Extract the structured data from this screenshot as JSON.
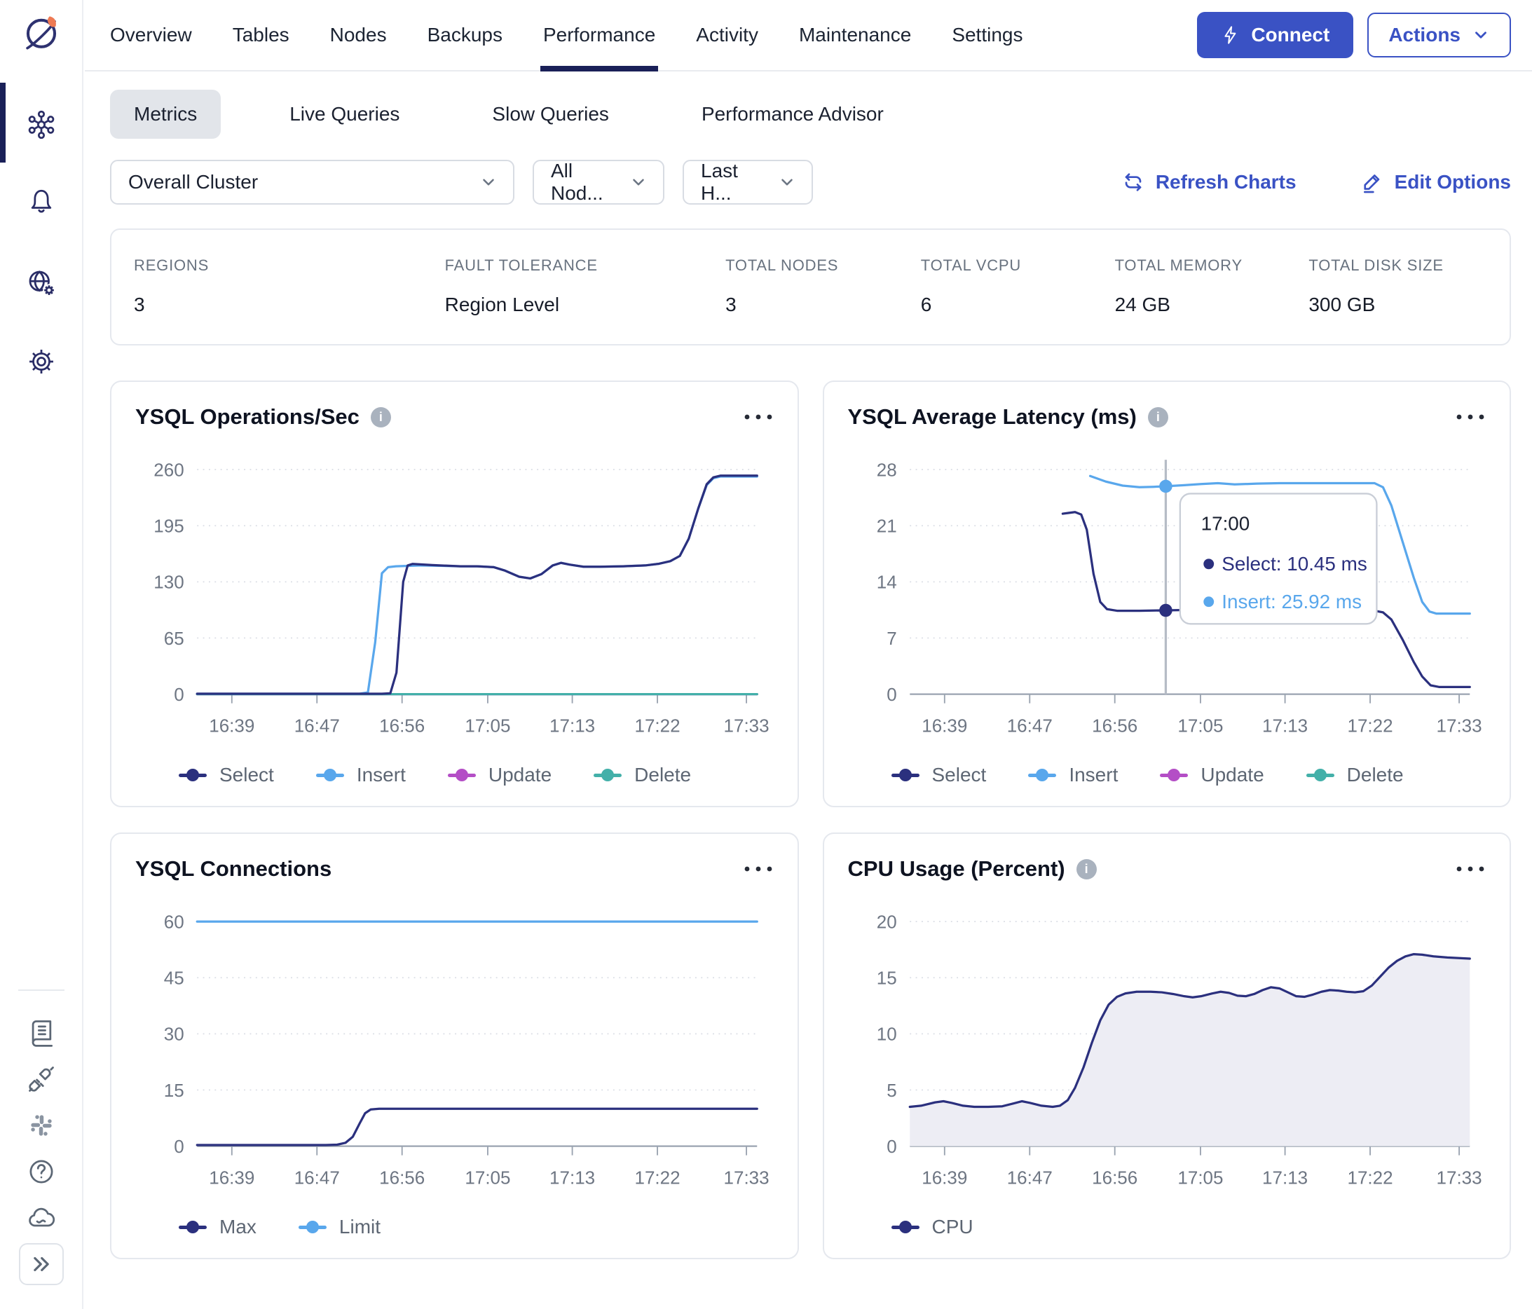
{
  "nav": {
    "tabs": [
      {
        "label": "Overview",
        "active": false
      },
      {
        "label": "Tables",
        "active": false
      },
      {
        "label": "Nodes",
        "active": false
      },
      {
        "label": "Backups",
        "active": false
      },
      {
        "label": "Performance",
        "active": true
      },
      {
        "label": "Activity",
        "active": false
      },
      {
        "label": "Maintenance",
        "active": false
      },
      {
        "label": "Settings",
        "active": false
      }
    ],
    "connect_label": "Connect",
    "actions_label": "Actions"
  },
  "subtabs": {
    "items": [
      {
        "label": "Metrics",
        "active": true
      },
      {
        "label": "Live Queries",
        "active": false
      },
      {
        "label": "Slow Queries",
        "active": false
      },
      {
        "label": "Performance Advisor",
        "active": false
      }
    ]
  },
  "filters": {
    "cluster": {
      "value": "Overall Cluster"
    },
    "nodes": {
      "value": "All Nod..."
    },
    "time": {
      "value": "Last H..."
    },
    "refresh_label": "Refresh Charts",
    "edit_label": "Edit Options"
  },
  "stats": {
    "items": [
      {
        "label": "REGIONS",
        "value": "3"
      },
      {
        "label": "FAULT TOLERANCE",
        "value": "Region Level"
      },
      {
        "label": "TOTAL NODES",
        "value": "3"
      },
      {
        "label": "TOTAL vCPU",
        "value": "6"
      },
      {
        "label": "TOTAL MEMORY",
        "value": "24 GB"
      },
      {
        "label": "TOTAL DISK SIZE",
        "value": "300 GB"
      }
    ]
  },
  "colors": {
    "accent": "#3a52c4",
    "select_series": "#2b307e",
    "insert_series": "#59a7ec",
    "update_series": "#b44ec6",
    "delete_series": "#43b0a9",
    "active_underline": "#1a2058"
  },
  "chart_data": [
    {
      "id": "ysql-operations",
      "type": "line",
      "title": "YSQL Operations/Sec",
      "has_info": true,
      "ylim": [
        0,
        260
      ],
      "y_ticks": [
        0,
        65,
        130,
        195,
        260
      ],
      "x_ticks": [
        "16:39",
        "16:47",
        "16:56",
        "17:05",
        "17:13",
        "17:22",
        "17:33"
      ],
      "x_tick_t": [
        0.062,
        0.214,
        0.366,
        0.519,
        0.67,
        0.822,
        0.981
      ],
      "legend": [
        {
          "label": "Select",
          "color": "#2b307e"
        },
        {
          "label": "Insert",
          "color": "#59a7ec"
        },
        {
          "label": "Update",
          "color": "#b44ec6"
        },
        {
          "label": "Delete",
          "color": "#43b0a9"
        }
      ],
      "series": [
        {
          "name": "Update",
          "color": "#b44ec6",
          "points": [
            [
              0,
              0
            ],
            [
              1,
              0
            ]
          ]
        },
        {
          "name": "Delete",
          "color": "#43b0a9",
          "points": [
            [
              0,
              0
            ],
            [
              1,
              0
            ]
          ]
        },
        {
          "name": "Insert",
          "color": "#59a7ec",
          "points": [
            [
              0,
              0.5
            ],
            [
              0.29,
              0.5
            ],
            [
              0.305,
              2
            ],
            [
              0.318,
              60
            ],
            [
              0.33,
              140
            ],
            [
              0.341,
              147
            ],
            [
              0.355,
              148
            ],
            [
              0.4,
              149
            ],
            [
              0.44,
              148.5
            ],
            [
              0.47,
              148
            ],
            [
              0.5,
              148
            ],
            [
              0.53,
              147
            ],
            [
              0.55,
              143
            ],
            [
              0.575,
              136
            ],
            [
              0.595,
              134
            ],
            [
              0.615,
              139
            ],
            [
              0.635,
              149
            ],
            [
              0.65,
              152
            ],
            [
              0.665,
              150
            ],
            [
              0.69,
              147.5
            ],
            [
              0.72,
              147.5
            ],
            [
              0.76,
              148
            ],
            [
              0.8,
              149
            ],
            [
              0.825,
              151
            ],
            [
              0.845,
              154
            ],
            [
              0.862,
              160
            ],
            [
              0.878,
              180
            ],
            [
              0.895,
              215
            ],
            [
              0.91,
              242
            ],
            [
              0.922,
              250
            ],
            [
              0.935,
              252
            ],
            [
              1,
              252
            ]
          ]
        },
        {
          "name": "Select",
          "color": "#2b307e",
          "points": [
            [
              0,
              0.5
            ],
            [
              0.33,
              0.5
            ],
            [
              0.345,
              1
            ],
            [
              0.356,
              25
            ],
            [
              0.368,
              130
            ],
            [
              0.376,
              149
            ],
            [
              0.385,
              150.8
            ],
            [
              0.42,
              149.5
            ],
            [
              0.47,
              148
            ],
            [
              0.5,
              148
            ],
            [
              0.53,
              147
            ],
            [
              0.55,
              143
            ],
            [
              0.575,
              136
            ],
            [
              0.595,
              134
            ],
            [
              0.615,
              139
            ],
            [
              0.635,
              149
            ],
            [
              0.65,
              152
            ],
            [
              0.665,
              150
            ],
            [
              0.69,
              147.5
            ],
            [
              0.72,
              147.5
            ],
            [
              0.76,
              148
            ],
            [
              0.8,
              149
            ],
            [
              0.825,
              151
            ],
            [
              0.845,
              154
            ],
            [
              0.862,
              160
            ],
            [
              0.878,
              180
            ],
            [
              0.895,
              215
            ],
            [
              0.91,
              243
            ],
            [
              0.922,
              251
            ],
            [
              0.935,
              253
            ],
            [
              1,
              253
            ]
          ]
        }
      ]
    },
    {
      "id": "ysql-latency",
      "type": "line",
      "title": "YSQL Average Latency (ms)",
      "has_info": true,
      "ylim": [
        0,
        28
      ],
      "y_ticks": [
        0,
        7,
        14,
        21,
        28
      ],
      "x_ticks": [
        "16:39",
        "16:47",
        "16:56",
        "17:05",
        "17:13",
        "17:22",
        "17:33"
      ],
      "x_tick_t": [
        0.062,
        0.214,
        0.366,
        0.519,
        0.67,
        0.822,
        0.981
      ],
      "legend": [
        {
          "label": "Select",
          "color": "#2b307e"
        },
        {
          "label": "Insert",
          "color": "#59a7ec"
        },
        {
          "label": "Update",
          "color": "#b44ec6"
        },
        {
          "label": "Delete",
          "color": "#43b0a9"
        }
      ],
      "series": [
        {
          "name": "Insert",
          "color": "#59a7ec",
          "points": [
            [
              0.322,
              27.2
            ],
            [
              0.35,
              26.5
            ],
            [
              0.38,
              26.0
            ],
            [
              0.41,
              25.8
            ],
            [
              0.435,
              25.85
            ],
            [
              0.457,
              25.92
            ],
            [
              0.49,
              26.05
            ],
            [
              0.52,
              26.2
            ],
            [
              0.55,
              26.3
            ],
            [
              0.58,
              26.15
            ],
            [
              0.62,
              26.25
            ],
            [
              0.66,
              26.3
            ],
            [
              0.7,
              26.3
            ],
            [
              0.75,
              26.3
            ],
            [
              0.8,
              26.3
            ],
            [
              0.83,
              26.3
            ],
            [
              0.845,
              25.8
            ],
            [
              0.86,
              23.5
            ],
            [
              0.88,
              19.0
            ],
            [
              0.9,
              14.5
            ],
            [
              0.915,
              11.5
            ],
            [
              0.928,
              10.3
            ],
            [
              0.94,
              10.05
            ],
            [
              1,
              10.05
            ]
          ]
        },
        {
          "name": "Select",
          "color": "#2b307e",
          "points": [
            [
              0.273,
              22.5
            ],
            [
              0.295,
              22.7
            ],
            [
              0.306,
              22.4
            ],
            [
              0.316,
              20.5
            ],
            [
              0.328,
              15.0
            ],
            [
              0.34,
              11.5
            ],
            [
              0.352,
              10.6
            ],
            [
              0.37,
              10.4
            ],
            [
              0.41,
              10.4
            ],
            [
              0.457,
              10.45
            ],
            [
              0.5,
              10.5
            ],
            [
              0.55,
              10.55
            ],
            [
              0.6,
              10.65
            ],
            [
              0.64,
              10.5
            ],
            [
              0.68,
              10.5
            ],
            [
              0.72,
              10.5
            ],
            [
              0.76,
              10.45
            ],
            [
              0.8,
              10.45
            ],
            [
              0.83,
              10.4
            ],
            [
              0.845,
              10.2
            ],
            [
              0.86,
              9.3
            ],
            [
              0.88,
              6.8
            ],
            [
              0.9,
              4.0
            ],
            [
              0.915,
              2.2
            ],
            [
              0.93,
              1.1
            ],
            [
              0.945,
              0.9
            ],
            [
              1,
              0.9
            ]
          ]
        }
      ],
      "tooltip": {
        "t": 0.457,
        "time": "17:00",
        "rows": [
          {
            "label": "Select",
            "value": "10.45 ms",
            "text": "Select: 10.45 ms",
            "color": "#2b307e",
            "y": 10.45
          },
          {
            "label": "Insert",
            "value": "25.92 ms",
            "text": "Insert: 25.92 ms",
            "color": "#59a7ec",
            "y": 25.92
          }
        ]
      }
    },
    {
      "id": "ysql-connections",
      "type": "line",
      "title": "YSQL Connections",
      "has_info": false,
      "ylim": [
        0,
        60
      ],
      "y_ticks": [
        0,
        15,
        30,
        45,
        60
      ],
      "x_ticks": [
        "16:39",
        "16:47",
        "16:56",
        "17:05",
        "17:13",
        "17:22",
        "17:33"
      ],
      "x_tick_t": [
        0.062,
        0.214,
        0.366,
        0.519,
        0.67,
        0.822,
        0.981
      ],
      "legend": [
        {
          "label": "Max",
          "color": "#2b307e"
        },
        {
          "label": "Limit",
          "color": "#59a7ec"
        }
      ],
      "series": [
        {
          "name": "Limit",
          "color": "#59a7ec",
          "points": [
            [
              0,
              60
            ],
            [
              1,
              60
            ]
          ]
        },
        {
          "name": "Max",
          "color": "#2b307e",
          "points": [
            [
              0,
              0.3
            ],
            [
              0.23,
              0.3
            ],
            [
              0.25,
              0.4
            ],
            [
              0.265,
              0.9
            ],
            [
              0.278,
              2.5
            ],
            [
              0.29,
              6.0
            ],
            [
              0.3,
              8.8
            ],
            [
              0.31,
              9.8
            ],
            [
              0.325,
              10
            ],
            [
              0.5,
              10
            ],
            [
              0.75,
              10
            ],
            [
              1,
              10
            ]
          ]
        }
      ]
    },
    {
      "id": "cpu-usage",
      "type": "area",
      "title": "CPU Usage (Percent)",
      "has_info": true,
      "ylim": [
        0,
        20
      ],
      "y_ticks": [
        0,
        5,
        10,
        15,
        20
      ],
      "x_ticks": [
        "16:39",
        "16:47",
        "16:56",
        "17:05",
        "17:13",
        "17:22",
        "17:33"
      ],
      "x_tick_t": [
        0.062,
        0.214,
        0.366,
        0.519,
        0.67,
        0.822,
        0.981
      ],
      "legend": [
        {
          "label": "CPU",
          "color": "#2b307e"
        }
      ],
      "series": [
        {
          "name": "CPU",
          "color": "#2b307e",
          "fill": "#ededf4",
          "points": [
            [
              0,
              3.5
            ],
            [
              0.02,
              3.6
            ],
            [
              0.045,
              3.9
            ],
            [
              0.06,
              4.0
            ],
            [
              0.075,
              3.85
            ],
            [
              0.095,
              3.6
            ],
            [
              0.115,
              3.5
            ],
            [
              0.14,
              3.5
            ],
            [
              0.165,
              3.55
            ],
            [
              0.185,
              3.8
            ],
            [
              0.2,
              4.0
            ],
            [
              0.215,
              3.85
            ],
            [
              0.235,
              3.6
            ],
            [
              0.255,
              3.5
            ],
            [
              0.268,
              3.6
            ],
            [
              0.282,
              4.1
            ],
            [
              0.295,
              5.2
            ],
            [
              0.31,
              7.0
            ],
            [
              0.325,
              9.2
            ],
            [
              0.34,
              11.2
            ],
            [
              0.355,
              12.6
            ],
            [
              0.37,
              13.3
            ],
            [
              0.385,
              13.6
            ],
            [
              0.405,
              13.75
            ],
            [
              0.43,
              13.75
            ],
            [
              0.45,
              13.7
            ],
            [
              0.47,
              13.55
            ],
            [
              0.49,
              13.35
            ],
            [
              0.505,
              13.25
            ],
            [
              0.52,
              13.35
            ],
            [
              0.54,
              13.6
            ],
            [
              0.555,
              13.75
            ],
            [
              0.57,
              13.65
            ],
            [
              0.585,
              13.4
            ],
            [
              0.6,
              13.35
            ],
            [
              0.615,
              13.55
            ],
            [
              0.63,
              13.9
            ],
            [
              0.645,
              14.15
            ],
            [
              0.66,
              14.05
            ],
            [
              0.675,
              13.7
            ],
            [
              0.69,
              13.35
            ],
            [
              0.705,
              13.3
            ],
            [
              0.72,
              13.5
            ],
            [
              0.735,
              13.75
            ],
            [
              0.75,
              13.9
            ],
            [
              0.765,
              13.85
            ],
            [
              0.78,
              13.75
            ],
            [
              0.795,
              13.7
            ],
            [
              0.81,
              13.8
            ],
            [
              0.825,
              14.3
            ],
            [
              0.84,
              15.1
            ],
            [
              0.855,
              15.9
            ],
            [
              0.87,
              16.5
            ],
            [
              0.885,
              16.9
            ],
            [
              0.9,
              17.1
            ],
            [
              0.915,
              17.05
            ],
            [
              0.935,
              16.9
            ],
            [
              0.96,
              16.8
            ],
            [
              1,
              16.7
            ]
          ]
        }
      ]
    }
  ]
}
